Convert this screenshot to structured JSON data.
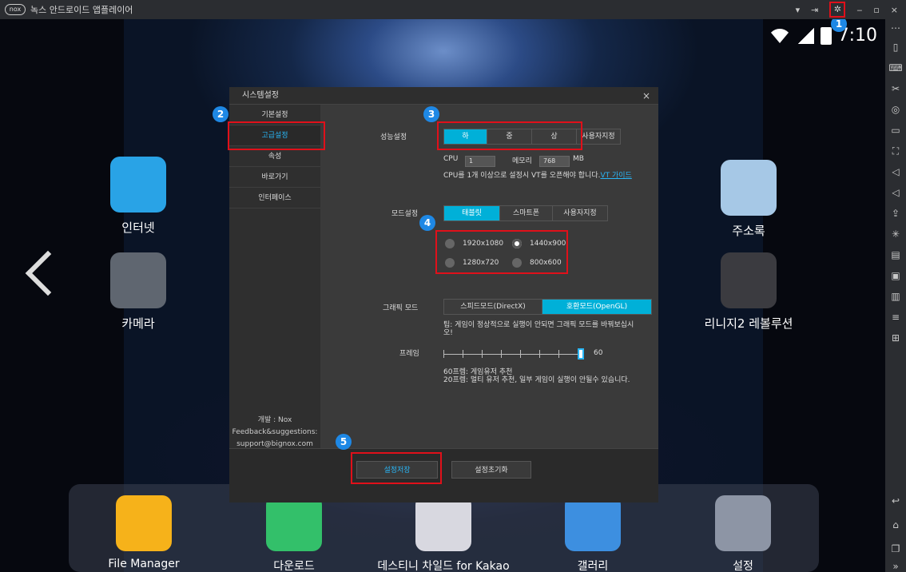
{
  "titlebar": {
    "logo": "nox",
    "title": "녹스 안드로이드 앱플레이어"
  },
  "status": {
    "time": "7:10"
  },
  "desktop": {
    "internet": "인터넷",
    "camera": "카메라",
    "contacts": "주소록",
    "lineage": "리니지2 레볼루션"
  },
  "dock": {
    "items": [
      "File Manager",
      "다운로드",
      "데스티니 차일드 for Kakao",
      "갤러리",
      "설정"
    ]
  },
  "badges": [
    "1",
    "2",
    "3",
    "4",
    "5"
  ],
  "dialog": {
    "title": "시스템설정",
    "close": "×",
    "nav": [
      "기본설정",
      "고급설정",
      "속성",
      "바로가기",
      "인터페이스"
    ],
    "dev": [
      "개발 : Nox",
      "Feedback&suggestions:",
      "support@bignox.com"
    ],
    "perf_label": "성능설정",
    "perf_options": [
      "하",
      "중",
      "상",
      "사용자지정"
    ],
    "cpu_label": "CPU",
    "cpu_value": "1",
    "mem_label": "메모리",
    "mem_value": "768",
    "mem_unit": "MB",
    "cpu_note": "CPU를 1개 이상으로 설정시 VT를 오픈해야 합니다.",
    "vt_link": "VT 가이드",
    "mode_label": "모드설정",
    "mode_options": [
      "태블릿",
      "스마트폰",
      "사용자지정"
    ],
    "resolutions": [
      "1920x1080",
      "1440x900",
      "1280x720",
      "800x600"
    ],
    "graphics_label": "그래픽 모드",
    "graphics_options": [
      "스피드모드(DirectX)",
      "호환모드(OpenGL)"
    ],
    "graphics_tip": "팁: 게임이 정상적으로 실행이 안되면 그래픽 모드를 바꿔보십시오!",
    "frame_label": "프레임",
    "frame_value": "60",
    "frame_note1": "60프렘: 게임유저 추천",
    "frame_note2": "20프렘: 멀티 유저 추천, 일부 게임이 실행이 안될수 있습니다.",
    "save": "설정저장",
    "reset": "설정초기화"
  }
}
